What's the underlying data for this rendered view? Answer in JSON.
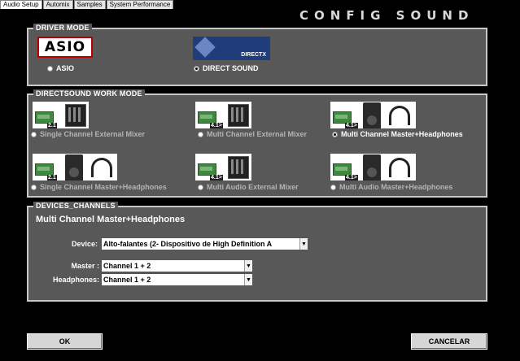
{
  "tabs": [
    {
      "label": "Audio Setup"
    },
    {
      "label": "Automix"
    },
    {
      "label": "Samples"
    },
    {
      "label": "System Performance"
    }
  ],
  "title": "CONFIG SOUND",
  "driver_mode": {
    "legend": "DRIVER MODE",
    "asio_logo": "ASIO",
    "directx_logo": "DIRECTX",
    "options": [
      {
        "label": "ASIO",
        "selected": false
      },
      {
        "label": "DIRECT SOUND",
        "selected": true
      }
    ]
  },
  "work_mode": {
    "legend": "DIRECTSOUND WORK MODE",
    "options": [
      {
        "label": "Single Channel External Mixer",
        "thumb_tag": "2.1",
        "selected": false
      },
      {
        "label": "Multi Channel External Mixer",
        "thumb_tag": "4.1>",
        "selected": false
      },
      {
        "label": "Multi Channel Master+Headphones",
        "thumb_tag": "4.1>",
        "selected": true
      },
      {
        "label": "Single Channel Master+Headphones",
        "thumb_tag": "2.1",
        "selected": false
      },
      {
        "label": "Multi Audio External Mixer",
        "thumb_tag": "4.1>",
        "selected": false
      },
      {
        "label": "Multi Audio Master+Headphones",
        "thumb_tag": "4.1>",
        "selected": false
      }
    ]
  },
  "devices": {
    "legend": "DEVICES_CHANNELS",
    "heading": "Multi Channel Master+Headphones",
    "device_label": "Device:",
    "device_value": "Alto-falantes (2- Dispositivo de High Definition A",
    "master_label": "Master :",
    "master_value": "Channel 1 + 2",
    "headphones_label": "Headphones:",
    "headphones_value": "Channel 1 + 2"
  },
  "buttons": {
    "ok": "OK",
    "cancel": "CANCELAR"
  },
  "colors": {
    "panel": "#585858",
    "border": "#c8c8c8",
    "background": "#000000"
  }
}
